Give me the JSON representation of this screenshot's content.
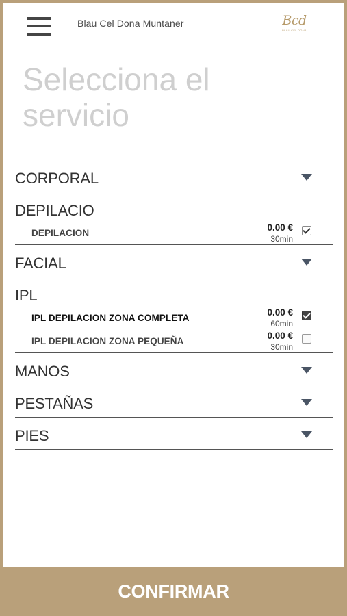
{
  "header": {
    "title": "Blau Cel Dona Muntaner",
    "logo_text": "Bcd",
    "logo_sub": "BLAU CEL DONA"
  },
  "page_title": "Selecciona el servicio",
  "categories": [
    {
      "name": "CORPORAL",
      "expanded": false
    },
    {
      "name": "DEPILACIO",
      "expanded": true,
      "items": [
        {
          "name": "DEPILACION",
          "price": "0.00 €",
          "duration": "30min",
          "checked": true
        }
      ]
    },
    {
      "name": "FACIAL",
      "expanded": false
    },
    {
      "name": "IPL",
      "expanded": true,
      "items": [
        {
          "name": "IPL DEPILACION ZONA COMPLETA",
          "price": "0.00 €",
          "duration": "60min",
          "checked": true
        },
        {
          "name": "IPL DEPILACION ZONA PEQUEÑA",
          "price": "0.00 €",
          "duration": "30min",
          "checked": false
        }
      ]
    },
    {
      "name": "MANOS",
      "expanded": false
    },
    {
      "name": "PESTAÑAS",
      "expanded": false
    },
    {
      "name": "PIES",
      "expanded": false
    }
  ],
  "confirm_label": "CONFIRMAR",
  "colors": {
    "accent": "#b9a07a",
    "title_gray": "#cfcfcf",
    "text": "#333333"
  },
  "icons": {
    "menu": "hamburger-menu-icon",
    "expand": "triangle-down-icon",
    "check": "checkbox-icon"
  }
}
